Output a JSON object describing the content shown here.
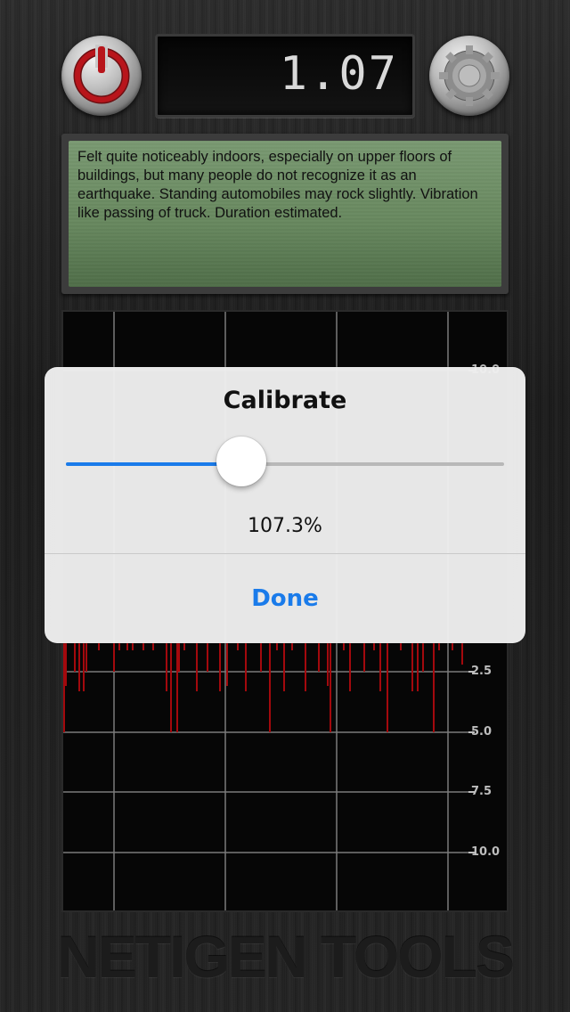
{
  "header": {
    "power_icon": "power-icon",
    "settings_icon": "gear-icon",
    "reading": "1.07"
  },
  "description": {
    "text": "Felt quite noticeably indoors, especially on upper floors of buildings, but many people do not recognize it as an earthquake. Standing automobiles may rock slightly. Vibration like passing of truck. Duration estimated."
  },
  "graph": {
    "axis_labels": [
      "10.0",
      "2.5",
      "5.0",
      "7.5",
      "10.0"
    ],
    "spike_color": "#a3090d",
    "grid_color": "#7a7a7a"
  },
  "brand": "NETIGEN TOOLS",
  "dialog": {
    "title": "Calibrate",
    "slider_fraction": 0.4,
    "value_text": "107.3%",
    "done_label": "Done",
    "accent": "#1a7bea"
  }
}
